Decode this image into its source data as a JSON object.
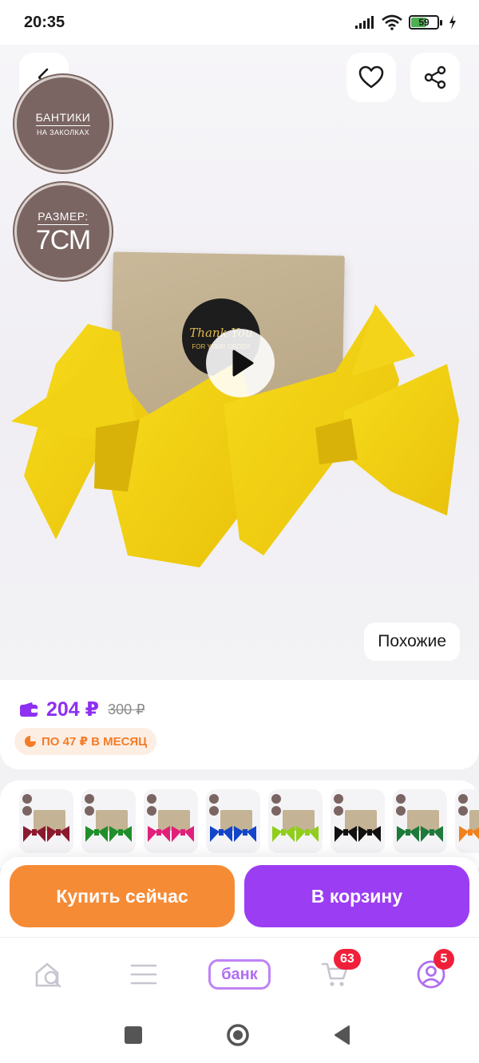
{
  "status_bar": {
    "time": "20:35",
    "battery_level": "59",
    "icons": [
      "signal-icon",
      "wifi-icon",
      "battery-icon",
      "charging-icon"
    ]
  },
  "product_image": {
    "badge_top": {
      "line1": "БАНТИКИ",
      "line2": "НА ЗАКОЛКАХ"
    },
    "badge_size": {
      "line1": "РАЗМЕР:",
      "line2": "7СМ"
    },
    "sticker": {
      "main": "Thank You",
      "sub": "FOR YOUR ORDER"
    },
    "similar_label": "Похожие"
  },
  "price": {
    "current": "204 ₽",
    "old": "300 ₽",
    "installment": "ПО 47 ₽ В МЕСЯЦ",
    "accent_color": "#8e30f2",
    "installment_color": "#f47c28"
  },
  "variants": [
    {
      "color": "#8b1a2e"
    },
    {
      "color": "#1e8f2a"
    },
    {
      "color": "#e0207a"
    },
    {
      "color": "#1245c8"
    },
    {
      "color": "#8fce1a"
    },
    {
      "color": "#111111"
    },
    {
      "color": "#1d7a3a"
    },
    {
      "color": "#f0821e"
    }
  ],
  "actions": {
    "buy_now": "Купить сейчас",
    "add_to_cart": "В корзину"
  },
  "bottom_nav": {
    "items": [
      {
        "icon": "home-search-icon"
      },
      {
        "icon": "catalog-menu-icon"
      },
      {
        "label": "банк",
        "icon": "bank-icon"
      },
      {
        "icon": "cart-icon",
        "badge": "63"
      },
      {
        "icon": "profile-icon",
        "badge": "5"
      }
    ]
  }
}
